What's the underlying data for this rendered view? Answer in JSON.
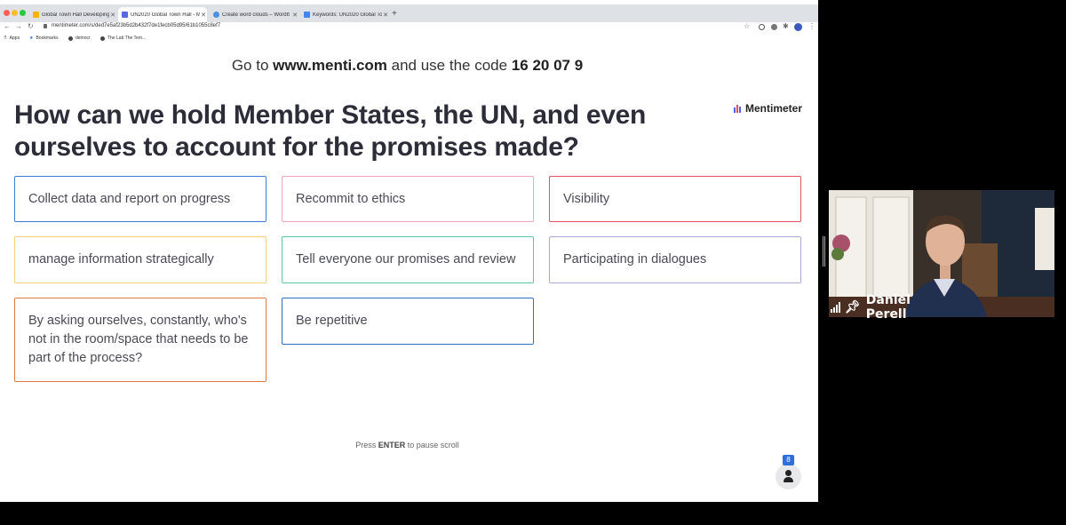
{
  "browser": {
    "tabs": [
      {
        "label": "Global Town Hall Developing a",
        "color": "#f4b400"
      },
      {
        "label": "UN2020 Global Town Hall - Me",
        "color": "#5769e0",
        "active": true
      },
      {
        "label": "Create word clouds – WordIt Ou",
        "color": "#4a90e2"
      },
      {
        "label": "Keywords: UN2020 Global Tow",
        "color": "#4285f4"
      }
    ],
    "url": "mentimeter.com/s/ded7e5af23b5d2b432f7de1fecb05d95/61b1055c8ef7",
    "bookmarks": [
      "Apps",
      "Bookmarks",
      "democr",
      "The Lab The Tem..."
    ]
  },
  "slide": {
    "join_prefix": "Go to ",
    "join_site": "www.menti.com",
    "join_middle": " and use the code ",
    "join_code": "16 20 07 9",
    "question_line1": "How can we hold Member States, the UN, and even",
    "question_line2": "ourselves to account for the promises made?",
    "brand": "Mentimeter",
    "responses": [
      {
        "text": "Collect data and report on progress",
        "color": "#3d7dd8"
      },
      {
        "text": "Recommit to ethics",
        "color": "#f0a3c5"
      },
      {
        "text": "Visibility",
        "color": "#e2545f"
      },
      {
        "text": "manage information strategically",
        "color": "#f5d27a"
      },
      {
        "text": "Tell everyone our promises and review",
        "color": "#5cc9a0"
      },
      {
        "text": "Participating in dialogues",
        "color": "#a7abd6"
      },
      {
        "text": "By asking ourselves, constantly, who's not in the room/space that needs to be part of the process?",
        "color": "#e07a3e"
      },
      {
        "text": "Be repetitive",
        "color": "#2f6fc0"
      }
    ],
    "pause_prefix": "Press ",
    "pause_key": "ENTER",
    "pause_suffix": " to pause scroll",
    "participant_count": "8"
  },
  "video": {
    "speaker_name": "Daniel Perell"
  }
}
